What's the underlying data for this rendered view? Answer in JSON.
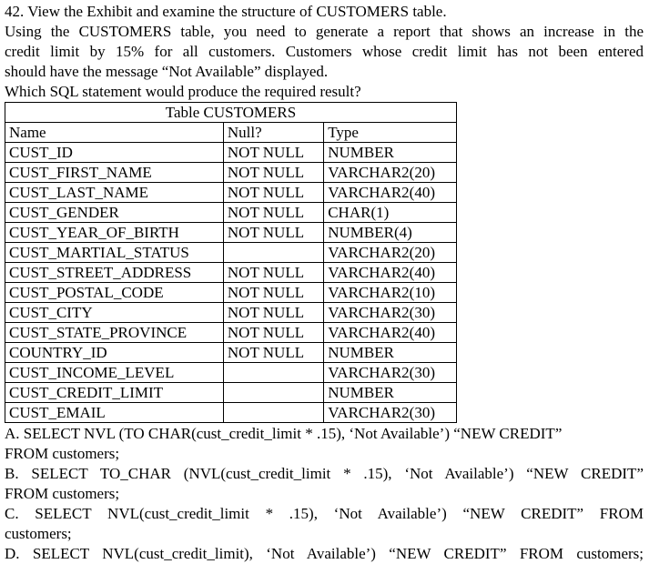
{
  "question": {
    "line1": "42. View the Exhibit and examine the structure of CUSTOMERS table.",
    "line2": "Using the CUSTOMERS table, you need to generate a report that shows an increase in the",
    "line3": "credit limit by 15% for all customers. Customers whose credit limit has not been entered",
    "line4": "should have the message “Not Available” displayed.",
    "line5": "Which SQL statement would produce the required result?"
  },
  "table": {
    "caption": "Table CUSTOMERS",
    "headers": [
      "Name",
      "Null?",
      "Type"
    ],
    "rows": [
      [
        "CUST_ID",
        "NOT NULL",
        "NUMBER"
      ],
      [
        "CUST_FIRST_NAME",
        "NOT NULL",
        "VARCHAR2(20)"
      ],
      [
        "CUST_LAST_NAME",
        "NOT NULL",
        "VARCHAR2(40)"
      ],
      [
        "CUST_GENDER",
        "NOT NULL",
        "CHAR(1)"
      ],
      [
        "CUST_YEAR_OF_BIRTH",
        "NOT NULL",
        "NUMBER(4)"
      ],
      [
        "CUST_MARTIAL_STATUS",
        "",
        "VARCHAR2(20)"
      ],
      [
        "CUST_STREET_ADDRESS",
        "NOT NULL",
        "VARCHAR2(40)"
      ],
      [
        "CUST_POSTAL_CODE",
        "NOT NULL",
        "VARCHAR2(10)"
      ],
      [
        "CUST_CITY",
        "NOT NULL",
        "VARCHAR2(30)"
      ],
      [
        "CUST_STATE_PROVINCE",
        "NOT NULL",
        "VARCHAR2(40)"
      ],
      [
        "COUNTRY_ID",
        "NOT NULL",
        "NUMBER"
      ],
      [
        "CUST_INCOME_LEVEL",
        "",
        "VARCHAR2(30)"
      ],
      [
        "CUST_CREDIT_LIMIT",
        "",
        "NUMBER"
      ],
      [
        "CUST_EMAIL",
        "",
        "VARCHAR2(30)"
      ]
    ]
  },
  "options": {
    "a_line1": "A. SELECT NVL (TO CHAR(cust_credit_limit * .15), ‘Not Available’) “NEW CREDIT”",
    "a_line2": "FROM customers;",
    "b_line1": "B. SELECT TO_CHAR (NVL(cust_credit_limit * .15), ‘Not Available’) “NEW CREDIT”",
    "b_line2": "FROM customers;",
    "c_line1": "C. SELECT NVL(cust_credit_limit * .15), ‘Not Available’) “NEW CREDIT” FROM",
    "c_line2": "customers;",
    "d_line1": "D. SELECT NVL(cust_credit_limit), ‘Not Available’) “NEW CREDIT” FROM customers;"
  }
}
